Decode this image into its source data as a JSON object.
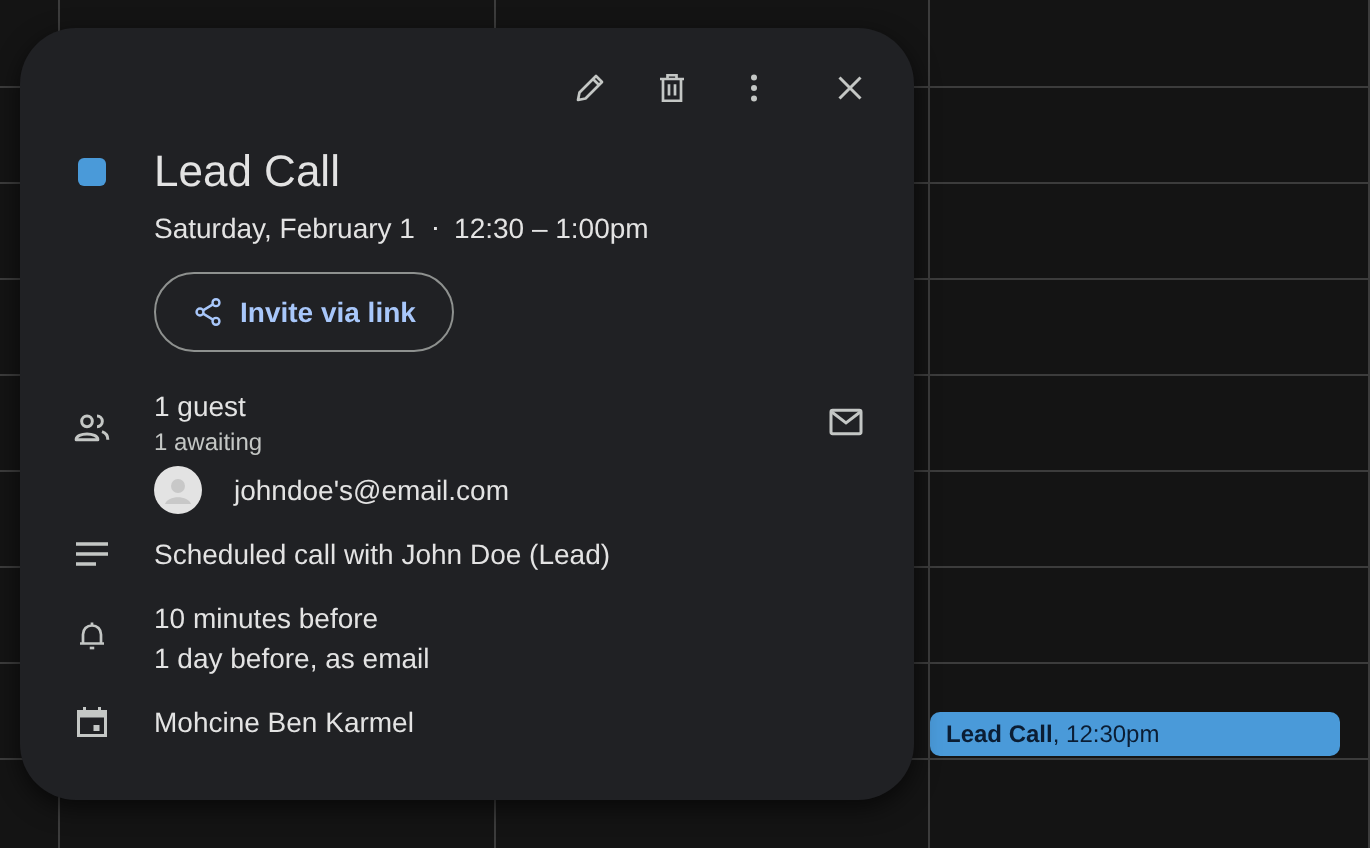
{
  "calendar": {
    "events": [
      {
        "label": "**Lead Call**, 12:30pm",
        "color": "#4a9ad9"
      }
    ]
  },
  "popup": {
    "title": "Lead Call",
    "color": "#4a9ad9",
    "when": "Saturday, February 1  ⋅  12:30 – 1:00pm",
    "invite_button": "Invite via link",
    "guests": {
      "count": "1 guest",
      "status": "1 awaiting",
      "list": [
        {
          "email": "johndoe's@email.com"
        }
      ]
    },
    "description": "Scheduled call with John Doe (Lead)",
    "reminders": [
      "10 minutes before",
      "1 day before, as email"
    ],
    "calendar_owner": "Mohcine Ben Karmel"
  }
}
